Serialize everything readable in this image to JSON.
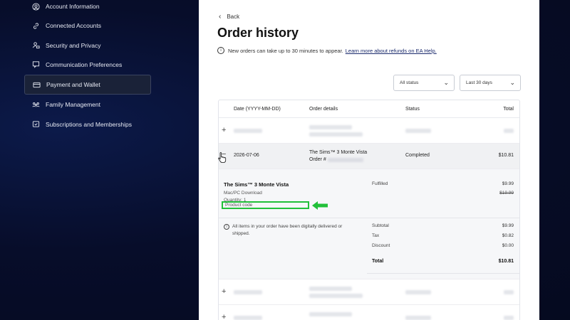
{
  "sidebar": {
    "items": [
      {
        "label": "Account Information",
        "icon": "user-icon"
      },
      {
        "label": "Connected Accounts",
        "icon": "link-icon"
      },
      {
        "label": "Security and Privacy",
        "icon": "lock-user-icon"
      },
      {
        "label": "Communication Preferences",
        "icon": "message-icon"
      },
      {
        "label": "Payment and Wallet",
        "icon": "card-icon",
        "active": true
      },
      {
        "label": "Family Management",
        "icon": "family-icon"
      },
      {
        "label": "Subscriptions and Memberships",
        "icon": "subscription-icon"
      }
    ]
  },
  "page": {
    "back": "Back",
    "title": "Order history",
    "notice": "New orders can take up to 30 minutes to appear.",
    "notice_link": "Learn more about refunds on EA Help."
  },
  "filters": {
    "status": "All status",
    "range": "Last 30 days"
  },
  "table": {
    "headers": {
      "date": "Date (YYYY-MM-DD)",
      "details": "Order details",
      "status": "Status",
      "total": "Total"
    },
    "expanded_row": {
      "date": "2026-07-06",
      "product": "The Sims™ 3 Monte Vista",
      "order_label": "Order #",
      "status": "Completed",
      "total": "$10.81"
    },
    "detail": {
      "name": "The Sims™ 3 Monte Vista",
      "platform": "Mac/PC Download",
      "quantity": "Quantity: 1",
      "product_code": "Product code",
      "fulfilled": "Fulfilled",
      "price": "$9.99",
      "price_old": "$19.99",
      "delivered_note": "All items in your order have been digitally delivered or shipped.",
      "subtotal_label": "Subtotal",
      "subtotal": "$9.99",
      "tax_label": "Tax",
      "tax": "$0.82",
      "discount_label": "Discount",
      "discount": "$0.00",
      "total_label": "Total",
      "total": "$10.81"
    }
  },
  "colors": {
    "highlight": "#22c03a",
    "background": "#070d2a"
  }
}
